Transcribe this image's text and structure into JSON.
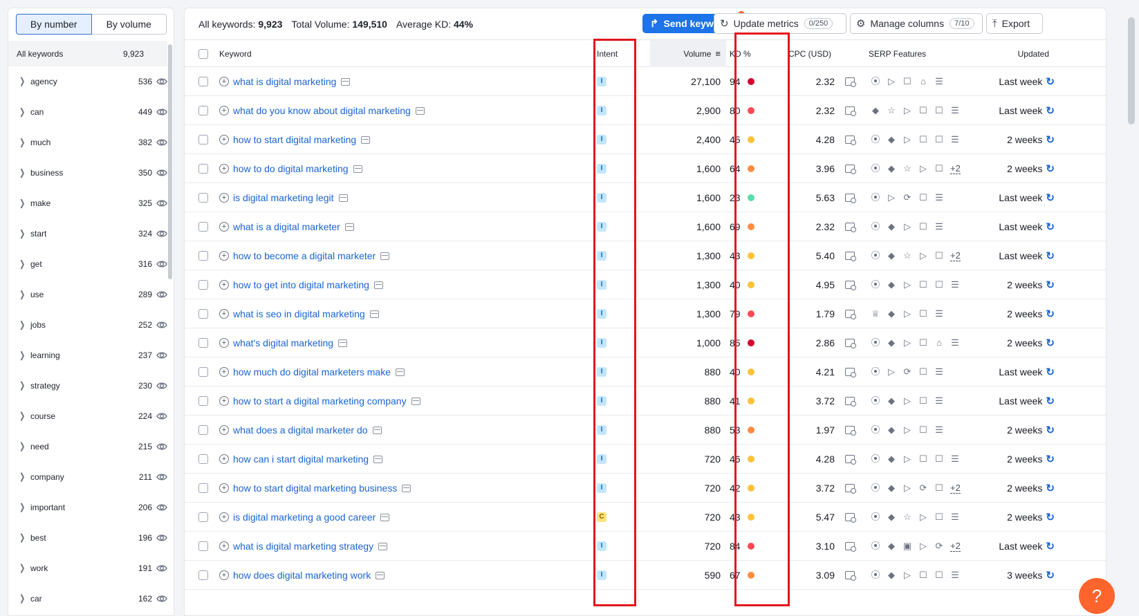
{
  "sidebar": {
    "tabs": [
      "By number",
      "By volume"
    ],
    "all_label": "All keywords",
    "all_count": "9,923",
    "groups": [
      {
        "name": "agency",
        "count": "536"
      },
      {
        "name": "can",
        "count": "449"
      },
      {
        "name": "much",
        "count": "382"
      },
      {
        "name": "business",
        "count": "350"
      },
      {
        "name": "make",
        "count": "325"
      },
      {
        "name": "start",
        "count": "324"
      },
      {
        "name": "get",
        "count": "316"
      },
      {
        "name": "use",
        "count": "289"
      },
      {
        "name": "jobs",
        "count": "252"
      },
      {
        "name": "learning",
        "count": "237"
      },
      {
        "name": "strategy",
        "count": "230"
      },
      {
        "name": "course",
        "count": "224"
      },
      {
        "name": "need",
        "count": "215"
      },
      {
        "name": "company",
        "count": "211"
      },
      {
        "name": "important",
        "count": "206"
      },
      {
        "name": "best",
        "count": "196"
      },
      {
        "name": "work",
        "count": "191"
      },
      {
        "name": "car",
        "count": "162"
      }
    ]
  },
  "toolbar": {
    "all_keywords_label": "All keywords:",
    "all_keywords_value": "9,923",
    "total_volume_label": "Total Volume:",
    "total_volume_value": "149,510",
    "avg_kd_label": "Average KD:",
    "avg_kd_value": "44%",
    "send_label": "Send keywords",
    "update_label": "Update metrics",
    "update_pill": "0/250",
    "manage_label": "Manage columns",
    "manage_pill": "7/10",
    "export_label": "Export"
  },
  "table": {
    "headers": {
      "keyword": "Keyword",
      "intent": "Intent",
      "volume": "Volume",
      "kd": "KD %",
      "cpc": "CPC (USD)",
      "serp": "SERP Features",
      "updated": "Updated"
    },
    "rows": [
      {
        "keyword": "what is digital marketing",
        "intent": "I",
        "volume": "27,100",
        "kd": "94",
        "kd_color": "#d1002f",
        "cpc": "2.32",
        "serp": [
          "link",
          "video",
          "snippet",
          "edu",
          "list"
        ],
        "updated": "Last week"
      },
      {
        "keyword": "what do you know about digital marketing",
        "intent": "I",
        "volume": "2,900",
        "kd": "80",
        "kd_color": "#ff4953",
        "cpc": "2.32",
        "serp": [
          "diamond",
          "star",
          "video",
          "snippet",
          "snippet",
          "list"
        ],
        "updated": "Last week"
      },
      {
        "keyword": "how to start digital marketing",
        "intent": "I",
        "volume": "2,400",
        "kd": "45",
        "kd_color": "#fdc23c",
        "cpc": "4.28",
        "serp": [
          "link",
          "diamond",
          "video",
          "snippet",
          "snippet",
          "list"
        ],
        "updated": "2 weeks"
      },
      {
        "keyword": "how to do digital marketing",
        "intent": "I",
        "volume": "1,600",
        "kd": "64",
        "kd_color": "#ff8c43",
        "cpc": "3.96",
        "serp": [
          "link",
          "diamond",
          "star",
          "video",
          "snippet",
          "+2"
        ],
        "updated": "2 weeks"
      },
      {
        "keyword": "is digital marketing legit",
        "intent": "I",
        "volume": "1,600",
        "kd": "23",
        "kd_color": "#59ddaa",
        "cpc": "5.63",
        "serp": [
          "link",
          "video",
          "play",
          "snippet",
          "list"
        ],
        "updated": "Last week"
      },
      {
        "keyword": "what is a digital marketer",
        "intent": "I",
        "volume": "1,600",
        "kd": "69",
        "kd_color": "#ff8c43",
        "cpc": "2.32",
        "serp": [
          "link",
          "diamond",
          "video",
          "snippet",
          "list"
        ],
        "updated": "Last week"
      },
      {
        "keyword": "how to become a digital marketer",
        "intent": "I",
        "volume": "1,300",
        "kd": "43",
        "kd_color": "#fdc23c",
        "cpc": "5.40",
        "serp": [
          "link",
          "diamond",
          "star",
          "video",
          "snippet",
          "+2"
        ],
        "updated": "Last week"
      },
      {
        "keyword": "how to get into digital marketing",
        "intent": "I",
        "volume": "1,300",
        "kd": "40",
        "kd_color": "#fdc23c",
        "cpc": "4.95",
        "serp": [
          "link",
          "diamond",
          "video",
          "snippet",
          "snippet",
          "list"
        ],
        "updated": "2 weeks"
      },
      {
        "keyword": "what is seo in digital marketing",
        "intent": "I",
        "volume": "1,300",
        "kd": "79",
        "kd_color": "#ff4953",
        "cpc": "1.79",
        "serp": [
          "crown",
          "diamond",
          "video",
          "snippet",
          "list"
        ],
        "updated": "2 weeks"
      },
      {
        "keyword": "what's digital marketing",
        "intent": "I",
        "volume": "1,000",
        "kd": "85",
        "kd_color": "#d1002f",
        "cpc": "2.86",
        "serp": [
          "link",
          "diamond",
          "video",
          "snippet",
          "edu",
          "list"
        ],
        "updated": "2 weeks"
      },
      {
        "keyword": "how much do digital marketers make",
        "intent": "I",
        "volume": "880",
        "kd": "40",
        "kd_color": "#fdc23c",
        "cpc": "4.21",
        "serp": [
          "link",
          "video",
          "play",
          "snippet",
          "list"
        ],
        "updated": "Last week"
      },
      {
        "keyword": "how to start a digital marketing company",
        "intent": "I",
        "volume": "880",
        "kd": "41",
        "kd_color": "#fdc23c",
        "cpc": "3.72",
        "serp": [
          "link",
          "diamond",
          "video",
          "snippet",
          "list"
        ],
        "updated": "Last week"
      },
      {
        "keyword": "what does a digital marketer do",
        "intent": "I",
        "volume": "880",
        "kd": "53",
        "kd_color": "#ff8c43",
        "cpc": "1.97",
        "serp": [
          "link",
          "diamond",
          "video",
          "snippet",
          "list"
        ],
        "updated": "2 weeks"
      },
      {
        "keyword": "how can i start digital marketing",
        "intent": "I",
        "volume": "720",
        "kd": "46",
        "kd_color": "#fdc23c",
        "cpc": "4.28",
        "serp": [
          "link",
          "diamond",
          "video",
          "snippet",
          "snippet",
          "list"
        ],
        "updated": "2 weeks"
      },
      {
        "keyword": "how to start digital marketing business",
        "intent": "I",
        "volume": "720",
        "kd": "42",
        "kd_color": "#fdc23c",
        "cpc": "3.72",
        "serp": [
          "link",
          "diamond",
          "video",
          "play",
          "snippet",
          "+2"
        ],
        "updated": "2 weeks"
      },
      {
        "keyword": "is digital marketing a good career",
        "intent": "C",
        "volume": "720",
        "kd": "43",
        "kd_color": "#fdc23c",
        "cpc": "5.47",
        "serp": [
          "link",
          "diamond",
          "star",
          "video",
          "snippet",
          "list"
        ],
        "updated": "2 weeks"
      },
      {
        "keyword": "what is digital marketing strategy",
        "intent": "I",
        "volume": "720",
        "kd": "84",
        "kd_color": "#ff4953",
        "cpc": "3.10",
        "serp": [
          "link",
          "diamond",
          "image",
          "video",
          "play",
          "+2"
        ],
        "updated": "Last week"
      },
      {
        "keyword": "how does digital marketing work",
        "intent": "I",
        "volume": "590",
        "kd": "67",
        "kd_color": "#ff8c43",
        "cpc": "3.09",
        "serp": [
          "link",
          "diamond",
          "video",
          "snippet",
          "snippet",
          "list"
        ],
        "updated": "3 weeks"
      }
    ]
  },
  "help_label": "?"
}
